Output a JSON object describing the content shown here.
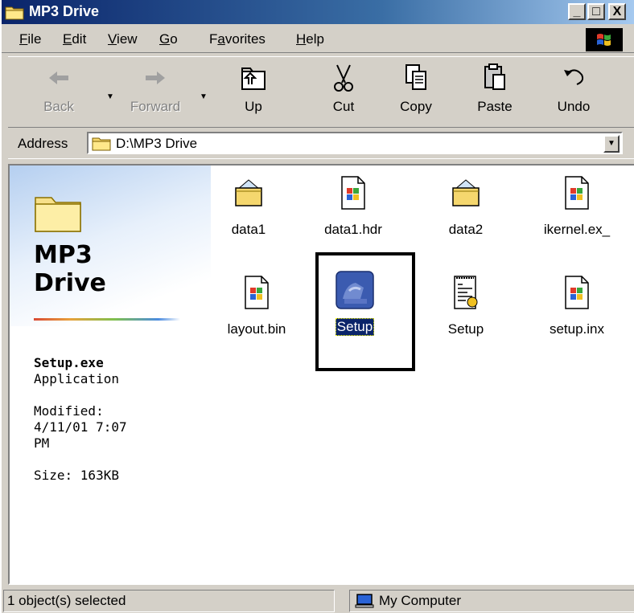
{
  "window": {
    "title": "MP3 Drive"
  },
  "titlebar_buttons": {
    "minimize": "_",
    "maximize": "□",
    "close": "X"
  },
  "menu": [
    "File",
    "Edit",
    "View",
    "Go",
    "Favorites",
    "Help"
  ],
  "menu_mnemonics": [
    "F",
    "E",
    "V",
    "G",
    "a",
    "H"
  ],
  "toolbar": [
    {
      "label": "Back",
      "icon": "back-arrow-icon",
      "enabled": false
    },
    {
      "label": "Forward",
      "icon": "forward-arrow-icon",
      "enabled": false
    },
    {
      "label": "Up",
      "icon": "up-folder-icon",
      "enabled": true
    },
    {
      "label": "Cut",
      "icon": "scissors-icon",
      "enabled": true
    },
    {
      "label": "Copy",
      "icon": "copy-icon",
      "enabled": true
    },
    {
      "label": "Paste",
      "icon": "paste-icon",
      "enabled": true
    },
    {
      "label": "Undo",
      "icon": "undo-icon",
      "enabled": true
    }
  ],
  "address": {
    "label": "Address",
    "value": "D:\\MP3 Drive"
  },
  "info_panel": {
    "title_line1": "MP3",
    "title_line2": "Drive",
    "file_name": "Setup.exe",
    "file_type": "Application",
    "modified_label": "Modified:",
    "modified_date": "4/11/01 7:07",
    "modified_ampm": "PM",
    "size": "Size: 163KB"
  },
  "files": [
    {
      "name": "data1",
      "icon": "zip-folder-icon",
      "selected": false
    },
    {
      "name": "data1.hdr",
      "icon": "windows-file-icon",
      "selected": false
    },
    {
      "name": "data2",
      "icon": "zip-folder-icon",
      "selected": false
    },
    {
      "name": "ikernel.ex_",
      "icon": "windows-file-icon",
      "selected": false
    },
    {
      "name": "layout.bin",
      "icon": "windows-file-icon",
      "selected": false
    },
    {
      "name": "Setup",
      "icon": "setup-installer-icon",
      "selected": true
    },
    {
      "name": "Setup",
      "icon": "setup-ini-icon",
      "selected": false
    },
    {
      "name": "setup.inx",
      "icon": "windows-file-icon",
      "selected": false
    }
  ],
  "status": {
    "selection": "1 object(s) selected",
    "zone": "My Computer"
  },
  "colors": {
    "titlebar": "#0a246a",
    "face": "#d4d0c8",
    "selection": "#0a246a"
  }
}
